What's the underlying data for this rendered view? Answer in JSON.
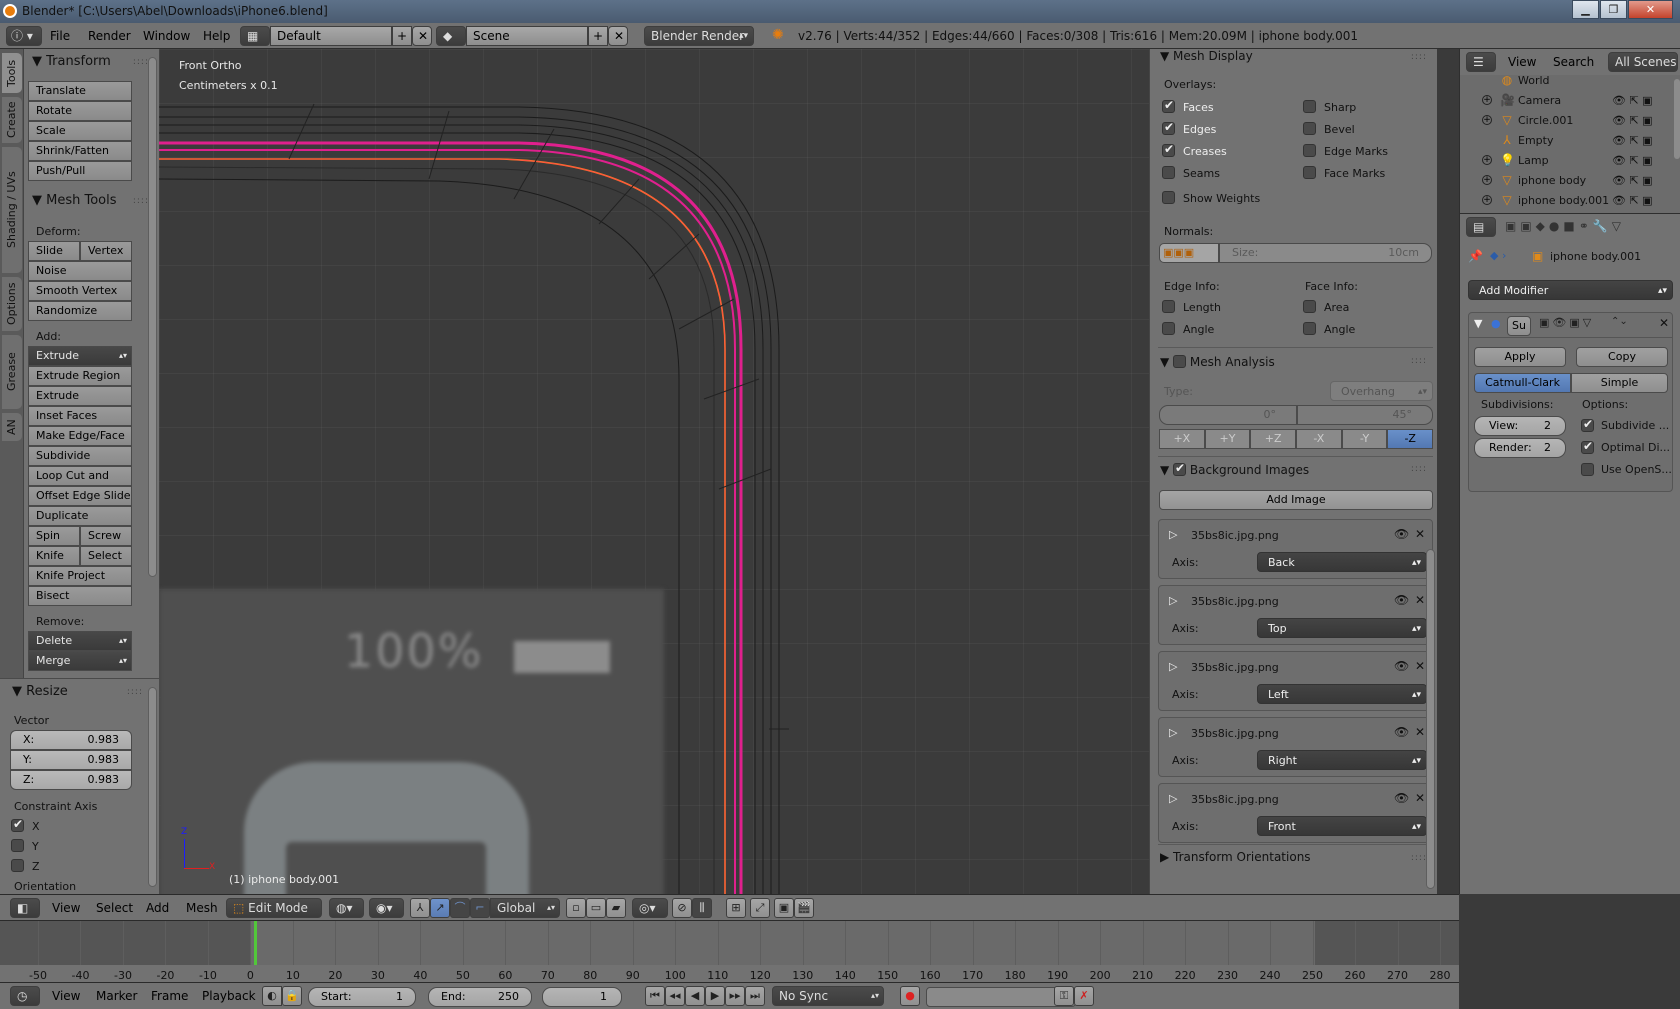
{
  "window": {
    "title": "Blender* [C:\\Users\\Abel\\Downloads\\iPhone6.blend]",
    "controls": {
      "minimize": "▁",
      "maximize": "❐",
      "close": "✕"
    }
  },
  "info_header": {
    "menus": [
      "File",
      "Render",
      "Window",
      "Help"
    ],
    "screen_layout": "Default",
    "scene": "Scene",
    "render_engine": "Blender Render",
    "stats": "v2.76 | Verts:44/352 | Edges:44/660 | Faces:0/308 | Tris:616 | Mem:20.09M | iphone body.001"
  },
  "tool_tabs": [
    "Tools",
    "Create",
    "Shading / UVs",
    "Options",
    "Grease Pencil",
    "AN"
  ],
  "tools": {
    "transform": {
      "title": "Transform",
      "buttons": [
        "Translate",
        "Rotate",
        "Scale",
        "Shrink/Fatten",
        "Push/Pull"
      ]
    },
    "mesh_tools": {
      "title": "Mesh Tools",
      "deform_label": "Deform:",
      "deform": {
        "slide_edge": "Slide Ed",
        "vertex": "Vertex",
        "noise": "Noise",
        "smooth_vertex": "Smooth Vertex",
        "randomize": "Randomize"
      },
      "add_label": "Add:",
      "extrude": "Extrude",
      "add": [
        "Extrude Region",
        "Extrude Individual",
        "Inset Faces",
        "Make Edge/Face",
        "Subdivide",
        "Loop Cut and Slide",
        "Offset Edge Slide",
        "Duplicate"
      ],
      "spin": "Spin",
      "screw": "Screw",
      "knife": "Knife",
      "select": "Select",
      "knife_project": "Knife Project",
      "bisect": "Bisect",
      "remove_label": "Remove:",
      "delete": "Delete",
      "merge": "Merge"
    },
    "resize": {
      "title": "Resize",
      "vector_label": "Vector",
      "x_label": "X:",
      "x": "0.983",
      "y_label": "Y:",
      "y": "0.983",
      "z_label": "Z:",
      "z": "0.983",
      "constraint_label": "Constraint Axis",
      "axes": [
        {
          "label": "X",
          "checked": true
        },
        {
          "label": "Y",
          "checked": false
        },
        {
          "label": "Z",
          "checked": false
        }
      ],
      "orientation_label": "Orientation"
    }
  },
  "viewport": {
    "view_name": "Front Ortho",
    "units": "Centimeters x 0.1",
    "object_label": "(1) iphone body.001",
    "bg_battery_text": "100%",
    "axis_z": "Z",
    "axis_x": "X",
    "colors": {
      "selected_edge": "#ff8c1a",
      "crease": "#e0208e",
      "background": "#3b3b3b"
    }
  },
  "n_panel": {
    "mesh_display": {
      "title": "Mesh Display",
      "overlays_label": "Overlays:",
      "left": [
        {
          "label": "Faces",
          "checked": true
        },
        {
          "label": "Edges",
          "checked": true
        },
        {
          "label": "Creases",
          "checked": true
        },
        {
          "label": "Seams",
          "checked": false
        }
      ],
      "right": [
        {
          "label": "Sharp",
          "checked": false
        },
        {
          "label": "Bevel",
          "checked": false
        },
        {
          "label": "Edge Marks",
          "checked": false
        },
        {
          "label": "Face Marks",
          "checked": false
        }
      ],
      "show_weights": "Show Weights",
      "normals_label": "Normals:",
      "size_label": "Size:",
      "size_value": "10cm",
      "edge_info_label": "Edge Info:",
      "face_info_label": "Face Info:",
      "edge_length": "Length",
      "edge_angle": "Angle",
      "face_area": "Area",
      "face_angle": "Angle"
    },
    "mesh_analysis": {
      "title": "Mesh Analysis",
      "type_label": "Type:",
      "type_value": "Overhang",
      "min": "0°",
      "max": "45°",
      "axes": [
        "+X",
        "+Y",
        "+Z",
        "-X",
        "-Y",
        "-Z"
      ],
      "active_axis": "-Z"
    },
    "background_images": {
      "title": "Background Images",
      "add_image": "Add Image",
      "axis_label": "Axis:",
      "images": [
        {
          "name": "35bs8ic.jpg.png",
          "axis": "Back"
        },
        {
          "name": "35bs8ic.jpg.png",
          "axis": "Top"
        },
        {
          "name": "35bs8ic.jpg.png",
          "axis": "Left"
        },
        {
          "name": "35bs8ic.jpg.png",
          "axis": "Right"
        },
        {
          "name": "35bs8ic.jpg.png",
          "axis": "Front"
        }
      ]
    },
    "transform_orientations": "Transform Orientations"
  },
  "outliner": {
    "menus": [
      "View",
      "Search"
    ],
    "filter": "All Scenes",
    "items": [
      "World",
      "Camera",
      "Circle.001",
      "Empty",
      "Lamp",
      "iphone body",
      "iphone body.001"
    ]
  },
  "properties": {
    "object_name": "iphone body.001",
    "add_modifier": "Add Modifier",
    "modifier_name": "Su",
    "apply": "Apply",
    "copy": "Copy",
    "catmull": "Catmull-Clark",
    "simple": "Simple",
    "subdivisions_label": "Subdivisions:",
    "options_label": "Options:",
    "view_label": "View:",
    "view_value": "2",
    "render_label": "Render:",
    "render_value": "2",
    "options": [
      {
        "label": "Subdivide ...",
        "checked": true
      },
      {
        "label": "Optimal Di...",
        "checked": true
      },
      {
        "label": "Use OpenS...",
        "checked": false
      }
    ]
  },
  "view3d_header": {
    "menus": [
      "View",
      "Select",
      "Add",
      "Mesh"
    ],
    "mode": "Edit Mode",
    "orientation": "Global"
  },
  "timeline": {
    "ticks": [
      -50,
      -40,
      -30,
      -20,
      -10,
      0,
      10,
      20,
      30,
      40,
      50,
      60,
      70,
      80,
      90,
      100,
      110,
      120,
      130,
      140,
      150,
      160,
      170,
      180,
      190,
      200,
      210,
      220,
      230,
      240,
      250,
      260,
      270,
      280
    ],
    "current_frame": 1
  },
  "timeline_header": {
    "menus": [
      "View",
      "Marker",
      "Frame",
      "Playback"
    ],
    "start_label": "Start:",
    "start": "1",
    "end_label": "End:",
    "end": "250",
    "frame": "1",
    "sync": "No Sync"
  }
}
